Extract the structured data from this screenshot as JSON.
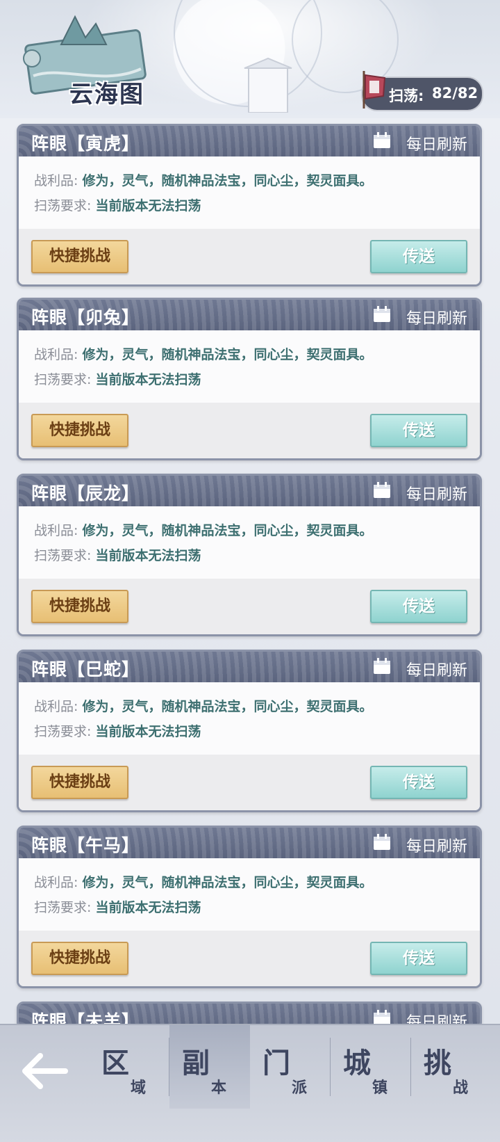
{
  "header": {
    "title": "云海图",
    "sweep_label": "扫荡:",
    "sweep_count": "82/82"
  },
  "cards": [
    {
      "name": "阵眼【寅虎】",
      "refresh": "每日刷新",
      "loot_label": "战利品:",
      "loot_value": "修为，灵气，随机神品法宝，同心尘，契灵面具。",
      "req_label": "扫荡要求:",
      "req_value": "当前版本无法扫荡",
      "quick_label": "快捷挑战",
      "teleport_label": "传送"
    },
    {
      "name": "阵眼【卯兔】",
      "refresh": "每日刷新",
      "loot_label": "战利品:",
      "loot_value": "修为，灵气，随机神品法宝，同心尘，契灵面具。",
      "req_label": "扫荡要求:",
      "req_value": "当前版本无法扫荡",
      "quick_label": "快捷挑战",
      "teleport_label": "传送"
    },
    {
      "name": "阵眼【辰龙】",
      "refresh": "每日刷新",
      "loot_label": "战利品:",
      "loot_value": "修为，灵气，随机神品法宝，同心尘，契灵面具。",
      "req_label": "扫荡要求:",
      "req_value": "当前版本无法扫荡",
      "quick_label": "快捷挑战",
      "teleport_label": "传送"
    },
    {
      "name": "阵眼【巳蛇】",
      "refresh": "每日刷新",
      "loot_label": "战利品:",
      "loot_value": "修为，灵气，随机神品法宝，同心尘，契灵面具。",
      "req_label": "扫荡要求:",
      "req_value": "当前版本无法扫荡",
      "quick_label": "快捷挑战",
      "teleport_label": "传送"
    },
    {
      "name": "阵眼【午马】",
      "refresh": "每日刷新",
      "loot_label": "战利品:",
      "loot_value": "修为，灵气，随机神品法宝，同心尘，契灵面具。",
      "req_label": "扫荡要求:",
      "req_value": "当前版本无法扫荡",
      "quick_label": "快捷挑战",
      "teleport_label": "传送"
    }
  ],
  "peek_card": {
    "name": "阵眼【未羊】",
    "refresh": "每日刷新"
  },
  "nav": {
    "tabs": [
      {
        "big": "区",
        "small": "域"
      },
      {
        "big": "副",
        "small": "本"
      },
      {
        "big": "门",
        "small": "派"
      },
      {
        "big": "城",
        "small": "镇"
      },
      {
        "big": "挑",
        "small": "战"
      }
    ],
    "active_tab": "副本"
  },
  "icons": {
    "back": "back-arrow-icon",
    "calendar": "calendar-icon",
    "sweep": "sweep-flag-icon"
  },
  "colors": {
    "card_header": "#5f6882",
    "quick_button": "#e9c47c",
    "teleport_button": "#9dd9d5",
    "loot_text": "#3d6f70"
  }
}
